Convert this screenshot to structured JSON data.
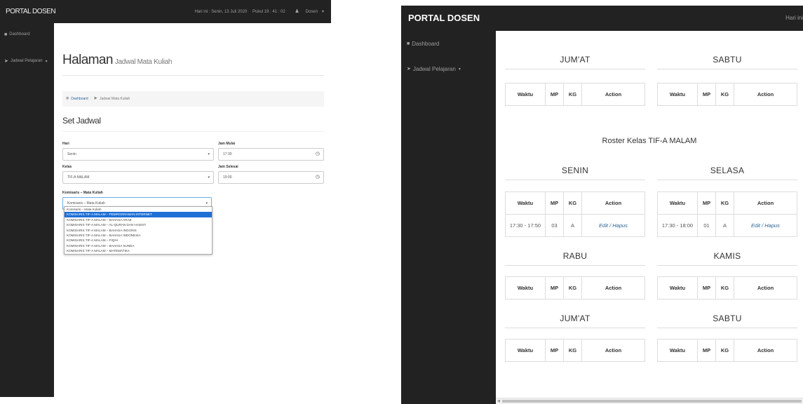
{
  "left": {
    "brand": "PORTAL DOSEN",
    "topbar": {
      "datetime": "Hari ini : Senin, 13 Juli 2020",
      "time": "Pukul 19 : 41 : 02",
      "user": "Dosen"
    },
    "sidebar": {
      "dashboard": "Dashboard",
      "jadwal": "Jadwal Pelajaran"
    },
    "page_title": "Halaman",
    "page_subtitle": "Jadwal Mata Kuliah",
    "breadcrumb": {
      "home": "Dashboard",
      "current": "Jadwal Mata Kuliah"
    },
    "section_title": "Set Jadwal",
    "form": {
      "hari_label": "Hari",
      "hari_value": "Senin",
      "jam_mulai_label": "Jam Mulai",
      "jam_mulai_value": "17:30",
      "kelas_label": "Kelas",
      "kelas_value": "TIF-A MALAM",
      "jam_selesai_label": "Jam Selesai",
      "jam_selesai_value": "19:00",
      "komisaris_label": "Komisaris – Mata Kuliah",
      "komisaris_value": "Komisaris – Mata Kuliah"
    },
    "dropdown_options": [
      "Komisaris – Mata Kuliah",
      "KOMISARIS TIF-A MALAM – PEMROGRAMAN INTERNET",
      "KOMISARIS TIF-A MALAM – BAHASA ARAB",
      "KOMISARIS TIF-A MALAM – AL-QURAN DAN HADIST",
      "KOMISARIS TIF-A MALAM – BAHASA INGGRIS",
      "KOMISARIS TIF-A MALAM – BAHASA INDONESIA",
      "KOMISARIS TIF-A MALAM – FIQIH",
      "KOMISARIS TIF-A MALAM – BAHASA SUNDA",
      "KOMISARIS TIF-A MALAM – MATEMATIKA"
    ],
    "dropdown_selected_index": 1
  },
  "right": {
    "brand": "PORTAL DOSEN",
    "topbar_text": "Hari ini",
    "sidebar": {
      "dashboard": "Dashboard",
      "jadwal": "Jadwal Pelajaran"
    },
    "columns": {
      "waktu": "Waktu",
      "mp": "MP",
      "kg": "KG",
      "action": "Action"
    },
    "days": {
      "jumat_top": "JUM'AT",
      "sabtu_top": "SABTU",
      "senin": "SENIN",
      "selasa": "SELASA",
      "rabu": "RABU",
      "kamis": "KAMIS",
      "jumat": "JUM'AT",
      "sabtu": "SABTU"
    },
    "roster_title": "Roster Kelas TIF-A MALAM",
    "senin_row": {
      "waktu": "17:30 - 17:50",
      "mp": "03",
      "kg": "A",
      "edit": "Edit",
      "sep": " / ",
      "hapus": "Hapus"
    },
    "selasa_row": {
      "waktu": "17:30 - 18:00",
      "mp": "01",
      "kg": "A",
      "edit": "Edit",
      "sep": " / ",
      "hapus": "Hapus"
    }
  },
  "colors": {
    "navbar": "#222222",
    "link": "#2a6496",
    "selected": "#1e6fd6"
  }
}
